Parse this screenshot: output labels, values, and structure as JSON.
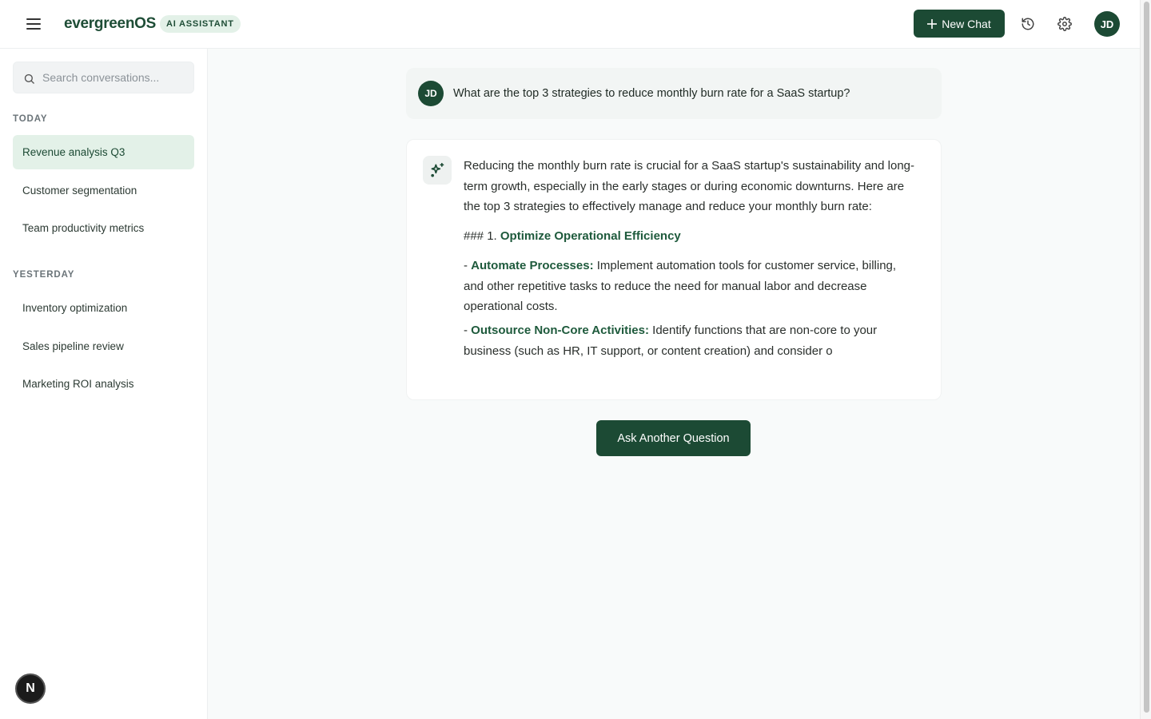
{
  "header": {
    "brand": "evergreenOS",
    "badge": "AI ASSISTANT",
    "new_chat_label": "New Chat",
    "avatar_initials": "JD"
  },
  "sidebar": {
    "search_placeholder": "Search conversations...",
    "sections": [
      {
        "title": "TODAY",
        "items": [
          "Revenue analysis Q3",
          "Customer segmentation",
          "Team productivity metrics"
        ]
      },
      {
        "title": "YESTERDAY",
        "items": [
          "Inventory optimization",
          "Sales pipeline review",
          "Marketing ROI analysis"
        ]
      }
    ],
    "bottom_badge": "N"
  },
  "chat": {
    "user": {
      "initials": "JD",
      "message": "What are the top 3 strategies to reduce monthly burn rate for a SaaS startup?"
    },
    "assistant": {
      "intro": "Reducing the monthly burn rate is crucial for a SaaS startup's sustainability and long-term growth, especially in the early stages or during economic downturns. Here are the top 3 strategies to effectively manage and reduce your monthly burn rate:",
      "heading_prefix": "### 1. ",
      "heading": "Optimize Operational Efficiency",
      "bullets": [
        {
          "prefix": "- ",
          "title": "Automate Processes:",
          "text": " Implement automation tools for customer service, billing, and other repetitive tasks to reduce the need for manual labor and decrease operational costs."
        },
        {
          "prefix": "- ",
          "title": "Outsource Non-Core Activities:",
          "text": " Identify functions that are non-core to your business (such as HR, IT support, or content creation) and consider o"
        }
      ]
    },
    "ask_button": "Ask Another Question"
  },
  "colors": {
    "accent": "#1c4a34",
    "accent_light": "#e3f1e8",
    "highlight_text": "#1e5a3c"
  }
}
